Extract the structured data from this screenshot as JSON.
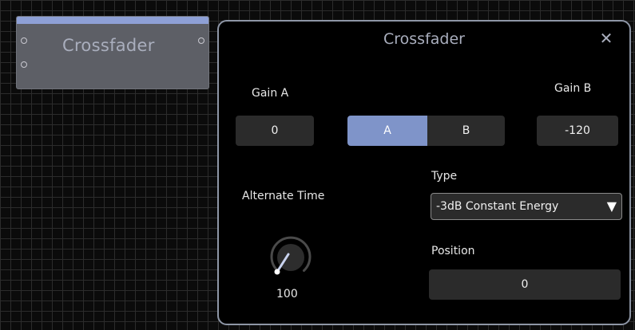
{
  "node": {
    "title": "Crossfader"
  },
  "panel": {
    "title": "Crossfader",
    "gain_a": {
      "label": "Gain A",
      "value": "0"
    },
    "gain_b": {
      "label": "Gain B",
      "value": "-120"
    },
    "ab_toggle": {
      "a_label": "A",
      "b_label": "B",
      "selected": "A"
    },
    "alternate_time": {
      "label": "Alternate Time",
      "value": "100"
    },
    "type": {
      "label": "Type",
      "selected": "-3dB Constant Energy"
    },
    "position": {
      "label": "Position",
      "value": "0"
    }
  },
  "icons": {
    "close": "close-icon",
    "dropdown": "triangle-down-icon",
    "port": "circle-port-icon"
  },
  "colors": {
    "accent": "#7f94c9",
    "node_bar": "#8ea0d6",
    "panel_border": "#8e96a6",
    "field_bg": "#2b2b2b"
  }
}
